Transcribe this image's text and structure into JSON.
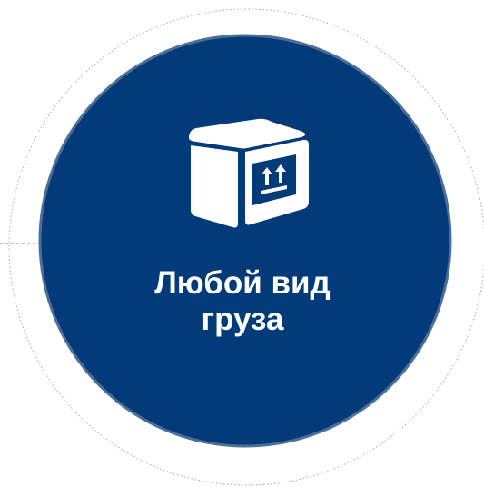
{
  "node": {
    "label_line1": "Любой вид",
    "label_line2": "груза",
    "icon": "cargo-box-this-side-up-icon"
  },
  "colors": {
    "circle_fill": "#023a7a",
    "circle_border": "#4d6e98",
    "icon": "#ffffff",
    "dotted_ring": "#a6a6a6",
    "text": "#ffffff"
  }
}
